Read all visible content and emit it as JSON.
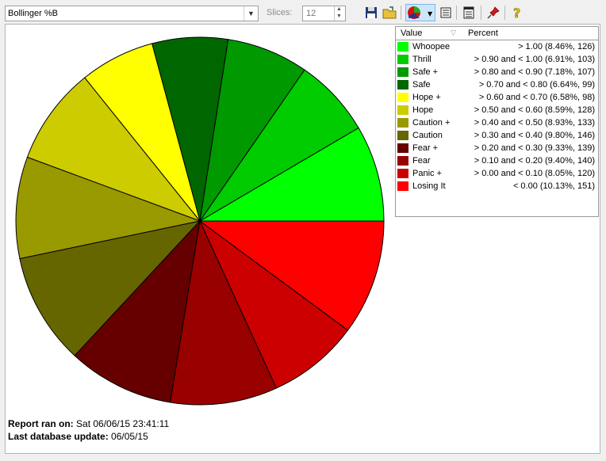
{
  "toolbar": {
    "indicator_select": "Bollinger %B",
    "slices_label": "Slices:",
    "slices_value": "12",
    "buttons": [
      "save-icon",
      "open-folder-icon",
      "pie-chart-icon",
      "dropdown-arrow-icon",
      "list-icon",
      "list-detail-icon",
      "pin-icon",
      "help-icon"
    ]
  },
  "legend": {
    "header_value": "Value",
    "header_percent": "Percent"
  },
  "chart_data": {
    "type": "pie",
    "slices": [
      {
        "name": "Whoopee",
        "label": "> 1.00 (8.46%, 126)",
        "value": 8.46,
        "count": 126,
        "color": "#00ff00"
      },
      {
        "name": "Thrill",
        "label": "> 0.90 and < 1.00 (6.91%, 103)",
        "value": 6.91,
        "count": 103,
        "color": "#00cc00"
      },
      {
        "name": "Safe +",
        "label": "> 0.80 and < 0.90 (7.18%, 107)",
        "value": 7.18,
        "count": 107,
        "color": "#009900"
      },
      {
        "name": "Safe",
        "label": "> 0.70 and < 0.80 (6.64%, 99)",
        "value": 6.64,
        "count": 99,
        "color": "#006600"
      },
      {
        "name": "Hope +",
        "label": "> 0.60 and < 0.70 (6.58%, 98)",
        "value": 6.58,
        "count": 98,
        "color": "#ffff00"
      },
      {
        "name": "Hope",
        "label": "> 0.50 and < 0.60 (8.59%, 128)",
        "value": 8.59,
        "count": 128,
        "color": "#cccc00"
      },
      {
        "name": "Caution +",
        "label": "> 0.40 and < 0.50 (8.93%, 133)",
        "value": 8.93,
        "count": 133,
        "color": "#999900"
      },
      {
        "name": "Caution",
        "label": "> 0.30 and < 0.40 (9.80%, 146)",
        "value": 9.8,
        "count": 146,
        "color": "#666600"
      },
      {
        "name": "Fear +",
        "label": "> 0.20 and < 0.30 (9.33%, 139)",
        "value": 9.33,
        "count": 139,
        "color": "#660000"
      },
      {
        "name": "Fear",
        "label": "> 0.10 and < 0.20 (9.40%, 140)",
        "value": 9.4,
        "count": 140,
        "color": "#990000"
      },
      {
        "name": "Panic +",
        "label": "> 0.00 and < 0.10 (8.05%, 120)",
        "value": 8.05,
        "count": 120,
        "color": "#cc0000"
      },
      {
        "name": "Losing It",
        "label": "< 0.00 (10.13%, 151)",
        "value": 10.13,
        "count": 151,
        "color": "#ff0000"
      }
    ]
  },
  "footer": {
    "report_label": "Report ran on:",
    "report_value": "Sat 06/06/15 23:41:11",
    "update_label": "Last database update:",
    "update_value": "06/05/15"
  }
}
